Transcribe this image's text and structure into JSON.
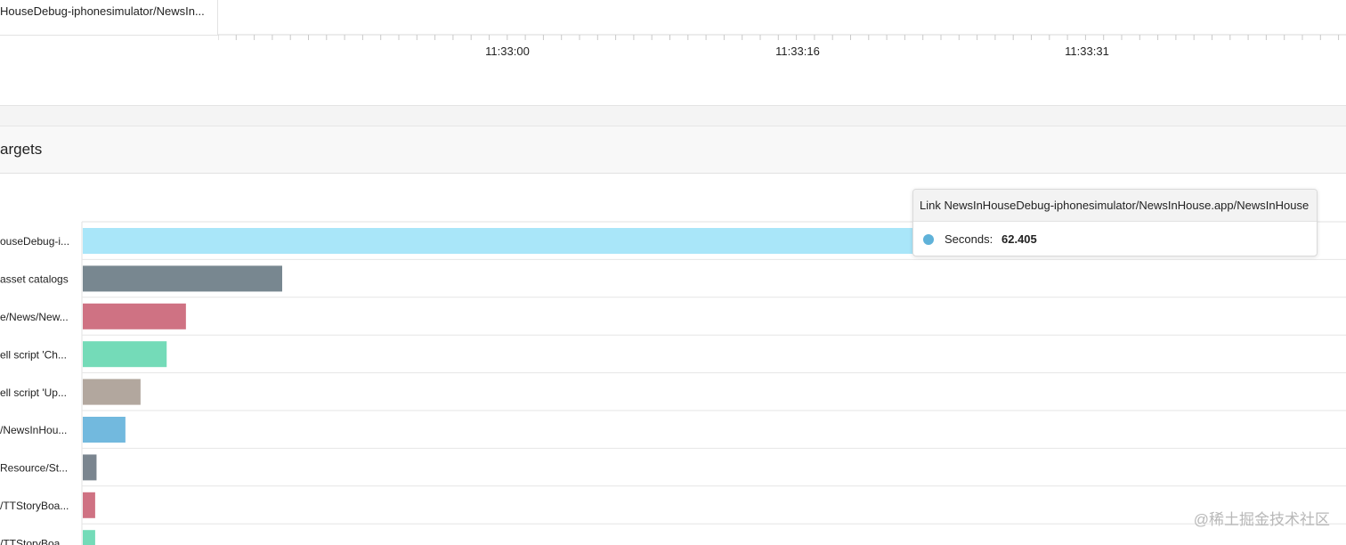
{
  "timeline": {
    "row_label": "HouseDebug-iphonesimulator/NewsIn...",
    "ticks": [
      "11:33:00",
      "11:33:16",
      "11:33:31"
    ]
  },
  "section": {
    "title": "argets"
  },
  "chart_data": {
    "type": "bar",
    "orientation": "horizontal",
    "categories": [
      "ouseDebug-i...",
      "asset catalogs",
      "e/News/New...",
      "ell script 'Ch...",
      "ell script 'Up...",
      "/NewsInHou...",
      "Resource/St...",
      "/TTStoryBoa...",
      "/TTStoryBoa..."
    ],
    "series": [
      {
        "name": "Seconds",
        "values": [
          62.405,
          14.5,
          7.5,
          6.1,
          4.2,
          3.1,
          1.0,
          0.9,
          0.9
        ]
      }
    ],
    "bar_colors": [
      "#a9e6f9",
      "#788790",
      "#cf7283",
      "#74dbb8",
      "#b2a79e",
      "#72b9de",
      "#7a858f",
      "#cf7283",
      "#74dbb8"
    ],
    "xlim": [
      0,
      62.405
    ],
    "grid": true
  },
  "tooltip": {
    "title": "Link NewsInHouseDebug-iphonesimulator/NewsInHouse.app/NewsInHouse",
    "label": "Seconds:",
    "value": "62.405",
    "dot_color": "#5fb2d9"
  },
  "watermark": "@稀土掘金技术社区"
}
